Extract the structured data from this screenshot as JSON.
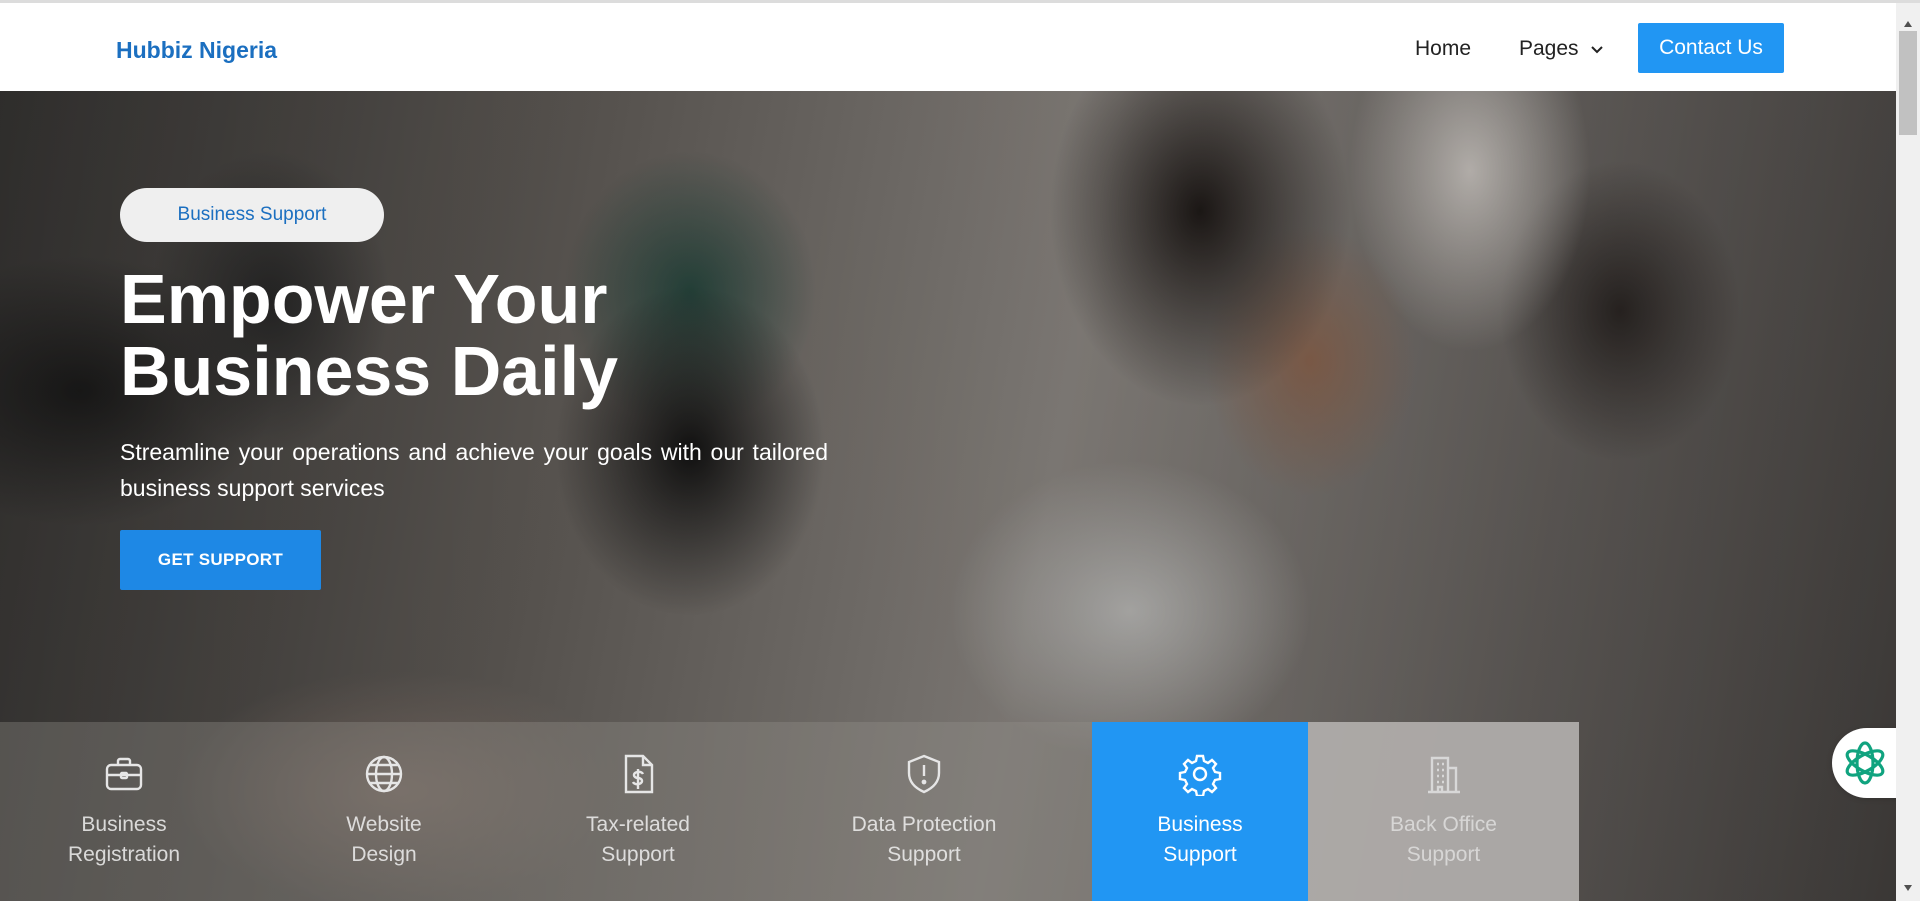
{
  "header": {
    "brand": "Hubbiz Nigeria",
    "nav": {
      "home": "Home",
      "pages": "Pages"
    },
    "contact_label": "Contact Us"
  },
  "hero": {
    "badge": "Business Support",
    "headline_line1": "Empower Your",
    "headline_line2": "Business Daily",
    "subtext": "Streamline your operations and achieve your goals with our tailored business support services",
    "cta_label": "GET SUPPORT"
  },
  "services": [
    {
      "line1": "Business",
      "line2": "Registration",
      "icon": "briefcase-icon"
    },
    {
      "line1": "Website",
      "line2": "Design",
      "icon": "globe-icon"
    },
    {
      "line1": "Tax-related",
      "line2": "Support",
      "icon": "dollar-document-icon"
    },
    {
      "line1": "Data Protection",
      "line2": "Support",
      "icon": "shield-alert-icon"
    },
    {
      "line1": "Business",
      "line2": "Support",
      "icon": "gear-icon",
      "active": true
    },
    {
      "line1": "Back Office",
      "line2": "Support",
      "icon": "building-icon"
    }
  ],
  "colors": {
    "brand_blue": "#1b6fc0",
    "accent_blue": "#2196f3",
    "cta_blue": "#1e88e5",
    "chat_green": "#10a37f"
  },
  "chat_widget": {
    "icon": "chatgpt-logo-icon"
  }
}
